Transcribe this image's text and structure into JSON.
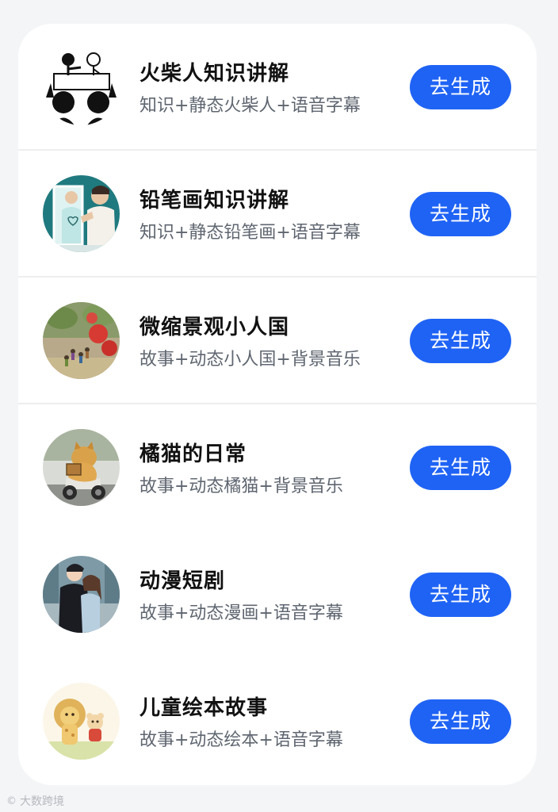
{
  "items": [
    {
      "title": "火柴人知识讲解",
      "subtitle": "知识+静态火柴人+语音字幕",
      "button": "去生成",
      "icon": "stickman-whiteboard-image"
    },
    {
      "title": "铅笔画知识讲解",
      "subtitle": "知识+静态铅笔画+语音字幕",
      "button": "去生成",
      "icon": "pencil-sketch-mirror-image"
    },
    {
      "title": "微缩景观小人国",
      "subtitle": "故事+动态小人国+背景音乐",
      "button": "去生成",
      "icon": "miniature-strawberry-image"
    },
    {
      "title": "橘猫的日常",
      "subtitle": "故事+动态橘猫+背景音乐",
      "button": "去生成",
      "icon": "orange-cat-scooter-image"
    },
    {
      "title": "动漫短剧",
      "subtitle": "故事+动态漫画+语音字幕",
      "button": "去生成",
      "icon": "anime-couple-image"
    },
    {
      "title": "儿童绘本故事",
      "subtitle": "故事+动态绘本+语音字幕",
      "button": "去生成",
      "icon": "lion-bear-picture-book-image"
    }
  ],
  "watermark": {
    "text": "大数跨境"
  },
  "colors": {
    "button": "#1f63f5",
    "title": "#111111",
    "subtitle": "#5f6670",
    "background": "#f4f5f7"
  }
}
